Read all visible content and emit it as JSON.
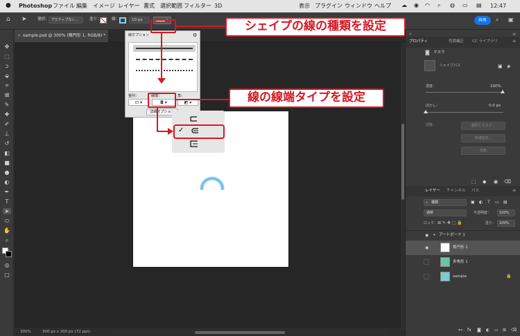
{
  "menubar": {
    "apple_icon": "apple-icon",
    "app_name": "Photoshop",
    "items": [
      "ファイル",
      "編集",
      "イメージ",
      "レイヤー",
      "書式",
      "選択範囲",
      "フィルター",
      "3D",
      "表示",
      "プラグイン",
      "ウィンドウ",
      "ヘルプ"
    ],
    "time": "12:47"
  },
  "options_bar": {
    "select_label": "選択：",
    "select_value": "アクティブなレ…",
    "fill_label": "塗り：",
    "stroke_label": "線：",
    "stroke_width": "10 px",
    "share_button": "共有"
  },
  "document_tab": {
    "title": "sample.psd @ 300% (楕円形 1, RGB/8) *"
  },
  "stroke_options_popup": {
    "title": "線オプション",
    "align_label": "整列：",
    "caps_label": "線端：",
    "corners_label": "角：",
    "more_options_button": "詳細オプション"
  },
  "cap_menu": {
    "items": [
      {
        "icon": "butt-cap-icon",
        "checked": false
      },
      {
        "icon": "round-cap-icon",
        "checked": true
      },
      {
        "icon": "square-cap-icon",
        "checked": false
      }
    ],
    "check_mark": "✓"
  },
  "callouts": {
    "stroke_type": "シェイプの線の種類を設定",
    "cap_type": "線の線端タイプを設定"
  },
  "status_bar": {
    "zoom": "300%",
    "doc_size": "300 px x 300 px (72 ppi)"
  },
  "properties_panel": {
    "tabs": [
      "プロパティ",
      "色調補正",
      "CC ライブラリ"
    ],
    "mask_label": "マスク",
    "shape_path_label": "シェイプパス",
    "density_label": "濃度：",
    "density_value": "100%",
    "feather_label": "ぼかし：",
    "feather_value": "0.0 px",
    "refine_label": "調整：",
    "buttons": [
      "選択とマスク…",
      "色域指定…",
      "反転"
    ]
  },
  "layers_panel": {
    "tabs": [
      "レイヤー",
      "チャンネル",
      "パス"
    ],
    "filter_label": "種類",
    "blend_mode": "通常",
    "opacity_label": "不透明度：",
    "opacity_value": "100%",
    "lock_label": "ロック：",
    "fill_label": "塗り：",
    "fill_value": "100%",
    "artboard_name": "アートボード 1",
    "layers": [
      {
        "name": "楕円形 1",
        "selected": true
      },
      {
        "name": "多角形 1",
        "selected": false
      },
      {
        "name": "sample",
        "selected": false
      }
    ]
  },
  "colors": {
    "accent": "#d31a24",
    "share_blue": "#1473e6",
    "arc_stroke": "#8ecdf3"
  }
}
